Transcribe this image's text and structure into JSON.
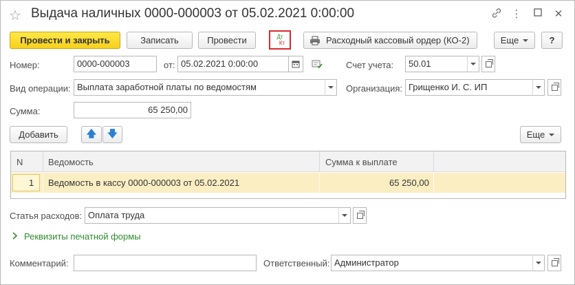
{
  "window": {
    "title": "Выдача наличных 0000-000003 от 05.02.2021 0:00:00"
  },
  "toolbar": {
    "post_and_close": "Провести и закрыть",
    "save": "Записать",
    "post": "Провести",
    "dtkt_top": "Дт",
    "dtkt_bottom": "Кт",
    "cash_order": "Расходный кассовый ордер (КО-2)",
    "more": "Еще",
    "help": "?"
  },
  "fields": {
    "number_label": "Номер:",
    "number_value": "0000-000003",
    "date_label": "от:",
    "date_value": "05.02.2021  0:00:00",
    "account_label": "Счет учета:",
    "account_value": "50.01",
    "operation_label": "Вид операции:",
    "operation_value": "Выплата заработной платы по ведомостям",
    "org_label": "Организация:",
    "org_value": "Грищенко И. С. ИП",
    "sum_label": "Сумма:",
    "sum_value": "65 250,00"
  },
  "table_bar": {
    "add": "Добавить",
    "more": "Еще"
  },
  "table": {
    "columns": [
      "N",
      "Ведомость",
      "Сумма к выплате"
    ],
    "rows": [
      {
        "n": "1",
        "statement": "Ведомость в кассу 0000-000003 от 05.02.2021",
        "amount": "65 250,00"
      }
    ]
  },
  "bottom": {
    "expense_label": "Статья расходов:",
    "expense_value": "Оплата труда",
    "print_details": "Реквизиты печатной формы",
    "comment_label": "Комментарий:",
    "comment_value": "",
    "responsible_label": "Ответственный:",
    "responsible_value": "Администратор"
  },
  "colors": {
    "accent_yellow": "#f7d11a",
    "selected_row": "#fbeec3",
    "link_green": "#2e8b2e",
    "dtkt_border": "#d9272e"
  }
}
